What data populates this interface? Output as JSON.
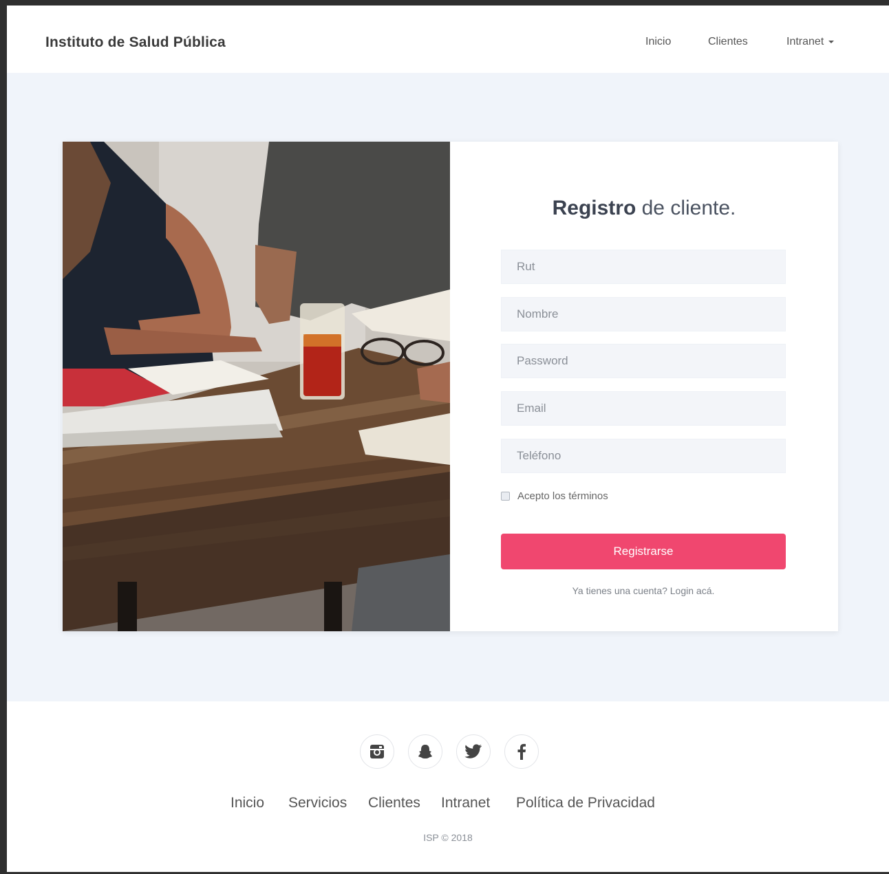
{
  "navbar": {
    "brand": "Instituto de Salud Pública",
    "links": [
      "Inicio",
      "Clientes",
      "Intranet"
    ]
  },
  "form": {
    "title_bold": "Registro",
    "title_rest": "de cliente.",
    "fields": {
      "rut": {
        "placeholder": "Rut",
        "value": ""
      },
      "nombre": {
        "placeholder": "Nombre",
        "value": ""
      },
      "password": {
        "placeholder": "Password",
        "value": ""
      },
      "email": {
        "placeholder": "Email",
        "value": ""
      },
      "telefono": {
        "placeholder": "Teléfono",
        "value": ""
      }
    },
    "terms_label": "Acepto los términos",
    "terms_checked": false,
    "submit_label": "Registrarse",
    "login_link": "Ya tienes una cuenta? Login acá."
  },
  "footer": {
    "social_icons": [
      "instagram-icon",
      "snapchat-icon",
      "twitter-icon",
      "facebook-icon"
    ],
    "links": [
      "Inicio",
      "Servicios",
      "Clientes",
      "Intranet",
      "Política de Privacidad"
    ],
    "copyright": "ISP © 2018"
  },
  "colors": {
    "accent": "#f0476f",
    "hero_background": "#f0f4fa",
    "input_background": "#f3f5f9",
    "brand_text": "#3a3a3a"
  }
}
